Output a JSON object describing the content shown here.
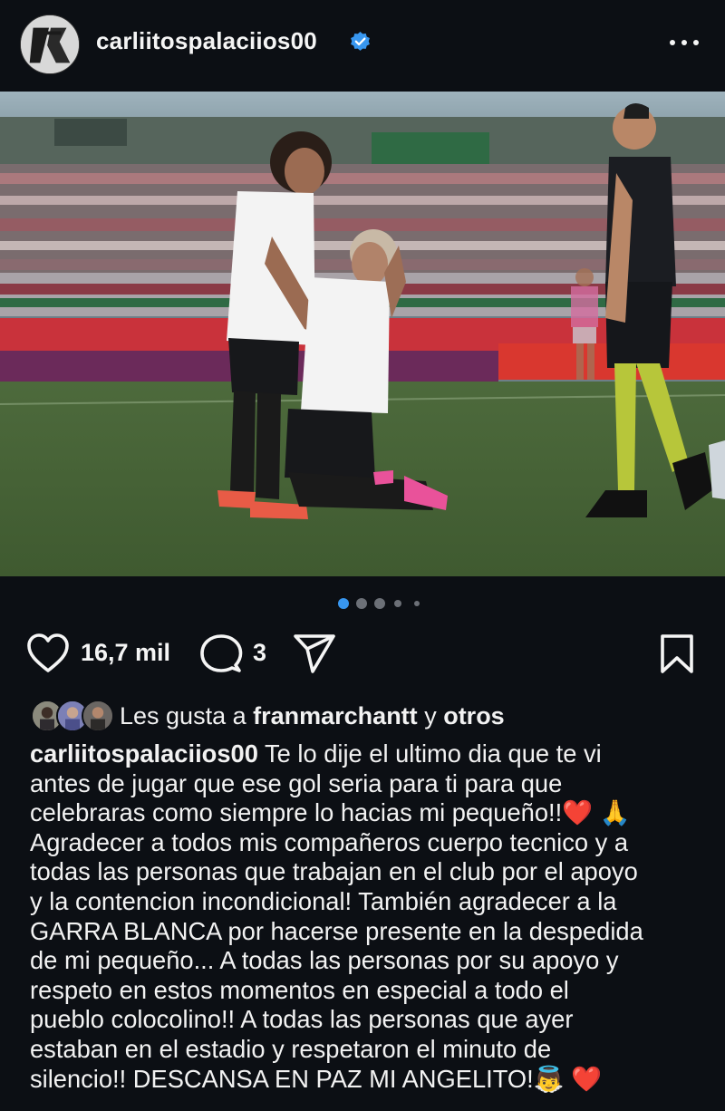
{
  "post": {
    "username": "carliitospalaciios00",
    "verified": true,
    "more_icon": "more-horizontal-icon"
  },
  "carousel": {
    "slide_count": 5,
    "active_index": 0
  },
  "actions": {
    "like_icon": "heart-outline-icon",
    "likes_count": "16,7 mil",
    "comment_icon": "comment-bubble-icon",
    "comments_count": "3",
    "share_icon": "send-paper-plane-icon",
    "save_icon": "bookmark-outline-icon"
  },
  "likes": {
    "prefix": "Les gusta a",
    "user": "franmarchantt",
    "joiner": "y",
    "others": "otros"
  },
  "caption": {
    "author": "carliitospalaciios00",
    "lines": [
      " Te lo dije el ultimo dia que te vi",
      "antes de jugar que ese gol seria para ti para que",
      "celebraras como siempre lo hacias mi pequeño!!❤️ 🙏",
      "Agradecer a todos mis compañeros cuerpo tecnico y a",
      "todas las personas que trabajan en el club por el apoyo",
      "y la contencion incondicional! También agradecer a la",
      "GARRA BLANCA por hacerse presente en la despedida",
      "de mi pequeño... A todas las personas por su apoyo y",
      "respeto en estos momentos en especial a todo el",
      "pueblo colocolino!! A todas las personas que ayer",
      "estaban en el estadio y respetaron el minuto de",
      "silencio!! DESCANSA EN PAZ MI ANGELITO!👼 ❤️"
    ]
  },
  "colors": {
    "background": "#0c0f14",
    "active_dot": "#3897f0",
    "inactive_dot": "#6c7077",
    "verified_badge": "#3897f0",
    "text": "#f2f2f2"
  }
}
